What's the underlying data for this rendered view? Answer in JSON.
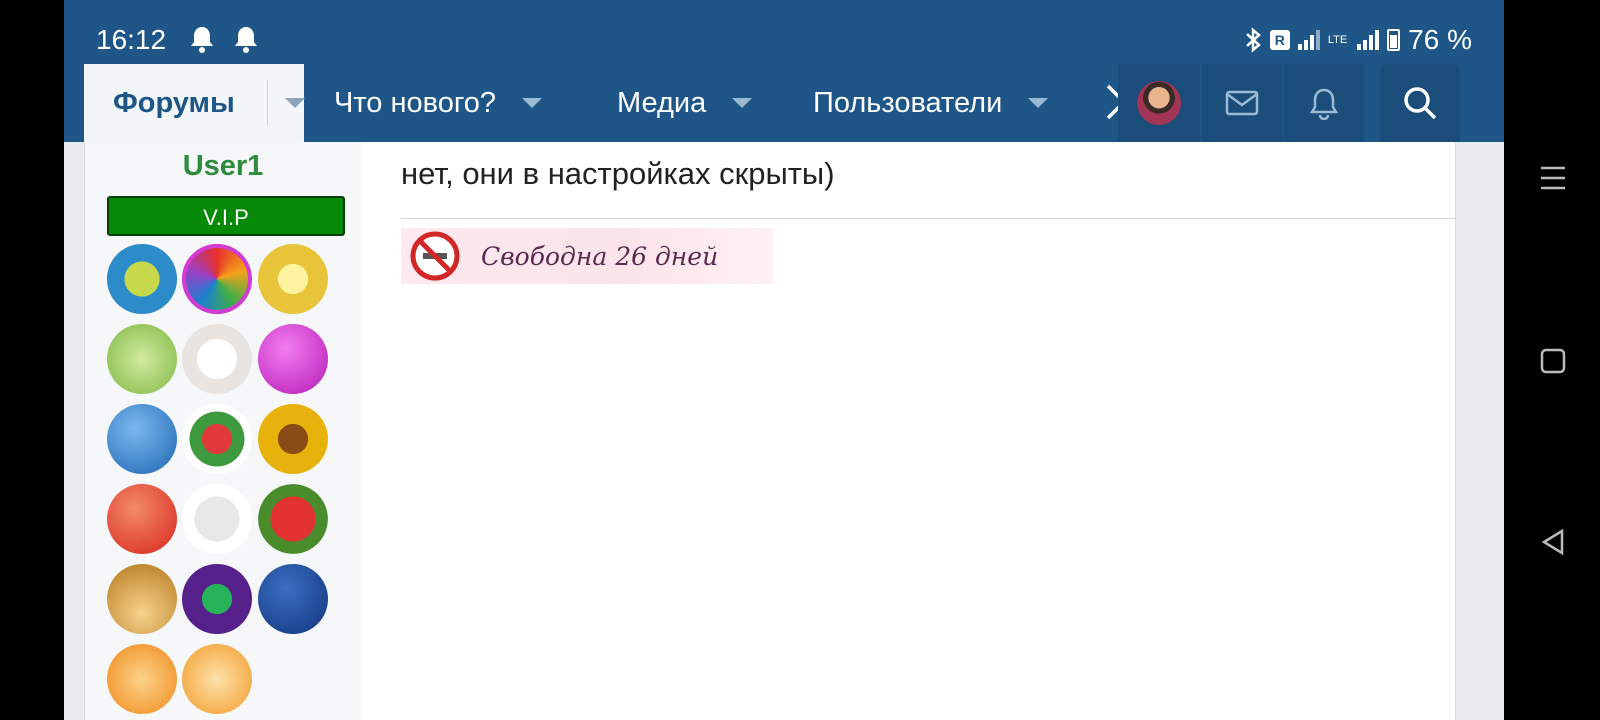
{
  "status_bar": {
    "time": "16:12",
    "battery": "76 %",
    "carrier_badge": "R",
    "network_label": "LTE",
    "icons": [
      "bell-icon",
      "bell-icon",
      "bluetooth-icon",
      "signal-icon",
      "battery-charging-icon"
    ]
  },
  "nav": {
    "forums": "Форумы",
    "whats_new": "Что нового?",
    "media": "Медиа",
    "users": "Пользователи"
  },
  "user": {
    "name": "User1",
    "badge": "V.I.P"
  },
  "post": {
    "message": "нет, они в настройках скрыты)",
    "signature": "Свободна 26 дней"
  },
  "colors": {
    "header_bg": "#1d5687",
    "username": "#2e8b3e",
    "vip_bg": "#058a07"
  }
}
